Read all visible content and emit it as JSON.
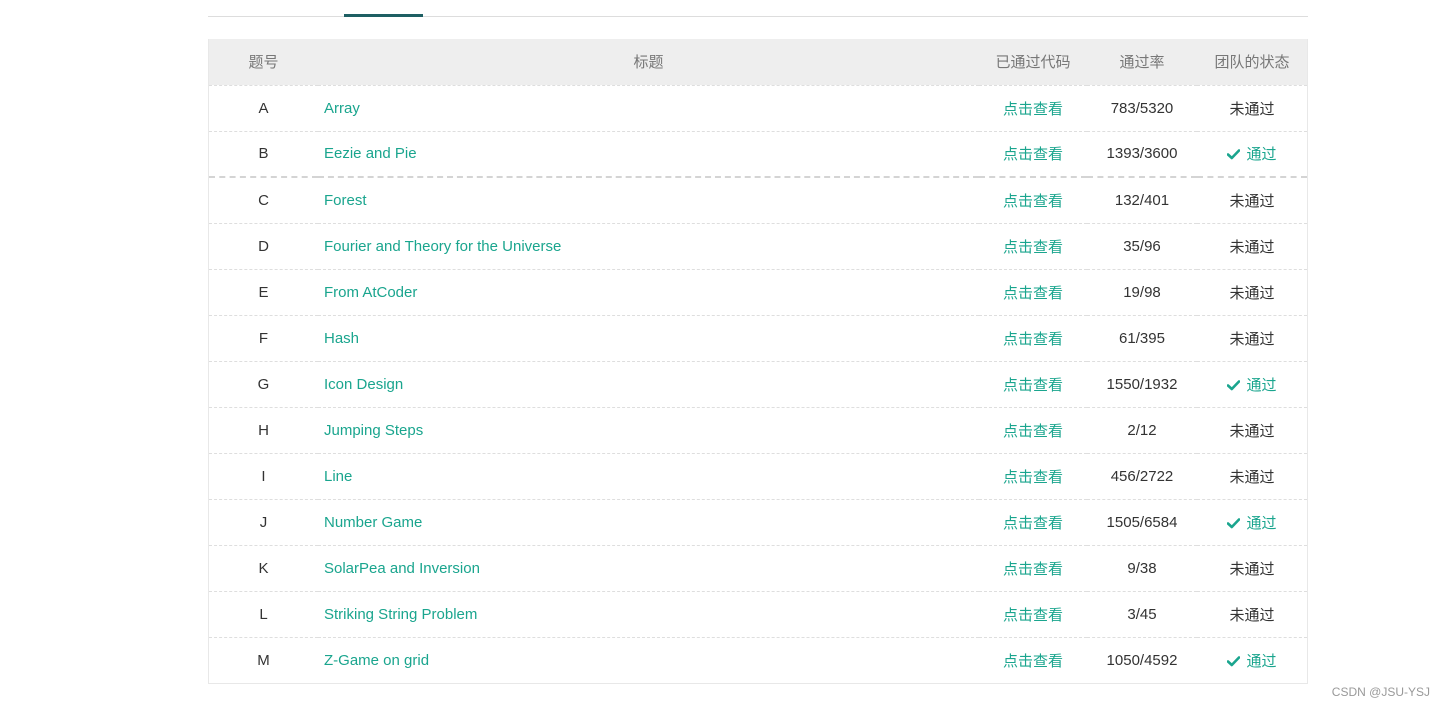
{
  "table": {
    "headers": {
      "id": "题号",
      "title": "标题",
      "code": "已通过代码",
      "rate": "通过率",
      "status": "团队的状态"
    },
    "rows": [
      {
        "id": "A",
        "title": "Array",
        "code": "点击查看",
        "rate": "783/5320",
        "status": "未通过",
        "passed": false
      },
      {
        "id": "B",
        "title": "Eezie and Pie",
        "code": "点击查看",
        "rate": "1393/3600",
        "status": "通过",
        "passed": true
      },
      {
        "id": "C",
        "title": "Forest",
        "code": "点击查看",
        "rate": "132/401",
        "status": "未通过",
        "passed": false
      },
      {
        "id": "D",
        "title": "Fourier and Theory for the Universe",
        "code": "点击查看",
        "rate": "35/96",
        "status": "未通过",
        "passed": false
      },
      {
        "id": "E",
        "title": "From AtCoder",
        "code": "点击查看",
        "rate": "19/98",
        "status": "未通过",
        "passed": false
      },
      {
        "id": "F",
        "title": "Hash",
        "code": "点击查看",
        "rate": "61/395",
        "status": "未通过",
        "passed": false
      },
      {
        "id": "G",
        "title": "Icon Design",
        "code": "点击查看",
        "rate": "1550/1932",
        "status": "通过",
        "passed": true
      },
      {
        "id": "H",
        "title": "Jumping Steps",
        "code": "点击查看",
        "rate": "2/12",
        "status": "未通过",
        "passed": false
      },
      {
        "id": "I",
        "title": "Line",
        "code": "点击查看",
        "rate": "456/2722",
        "status": "未通过",
        "passed": false
      },
      {
        "id": "J",
        "title": "Number Game",
        "code": "点击查看",
        "rate": "1505/6584",
        "status": "通过",
        "passed": true
      },
      {
        "id": "K",
        "title": "SolarPea and Inversion",
        "code": "点击查看",
        "rate": "9/38",
        "status": "未通过",
        "passed": false
      },
      {
        "id": "L",
        "title": "Striking String Problem",
        "code": "点击查看",
        "rate": "3/45",
        "status": "未通过",
        "passed": false
      },
      {
        "id": "M",
        "title": "Z-Game on grid",
        "code": "点击查看",
        "rate": "1050/4592",
        "status": "通过",
        "passed": true
      }
    ]
  },
  "watermark": "CSDN @JSU-YSJ",
  "colors": {
    "accent": "#1aa58e",
    "active_tab": "#1e5f63",
    "header_bg": "#eeeeee"
  },
  "icons": {
    "pass": "check-icon"
  }
}
